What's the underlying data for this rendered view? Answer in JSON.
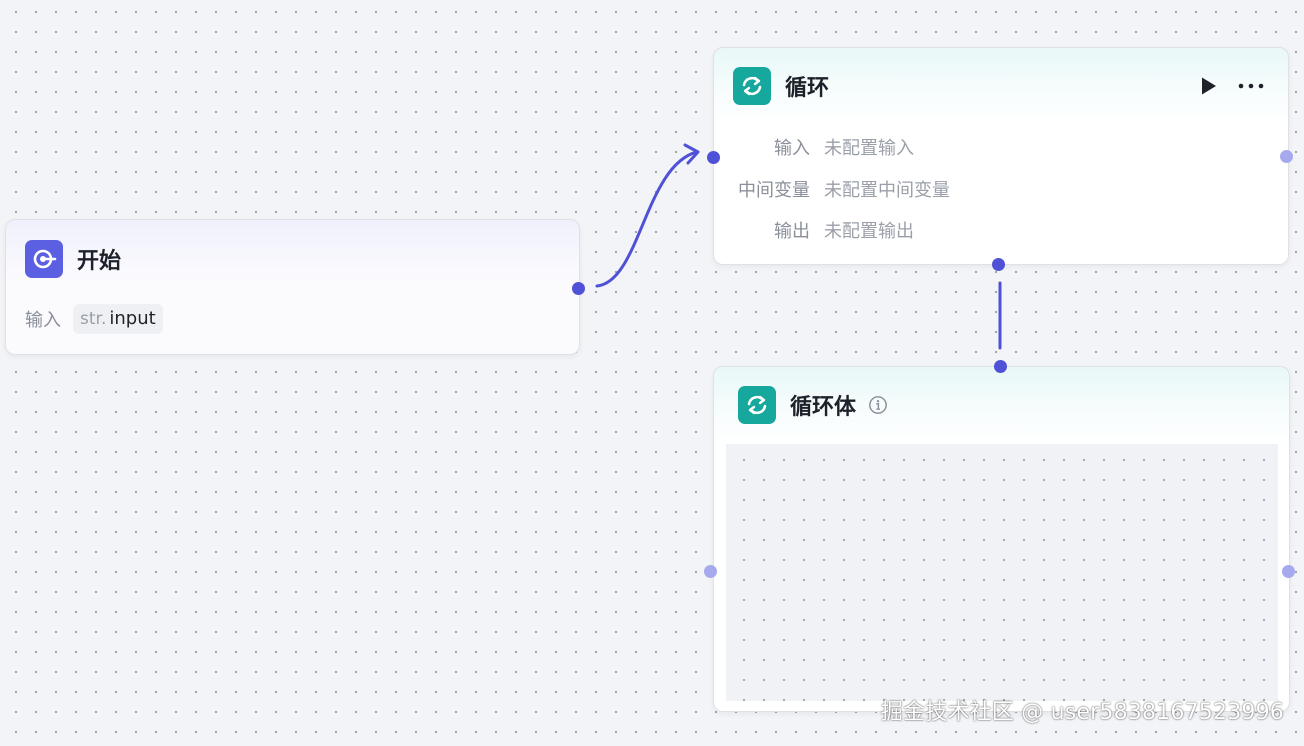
{
  "colors": {
    "canvas_bg": "#f3f4f7",
    "edge": "#4f52d6",
    "start_icon_bg": "#5b5fe2",
    "loop_icon_bg": "#16a89c"
  },
  "nodes": {
    "start": {
      "title": "开始",
      "icon": "start-icon",
      "input_label": "输入",
      "input_var": {
        "type": "str.",
        "name": "input"
      }
    },
    "loop": {
      "title": "循环",
      "icon": "loop-icon",
      "rows": [
        {
          "label": "输入",
          "value": "未配置输入"
        },
        {
          "label": "中间变量",
          "value": "未配置中间变量"
        },
        {
          "label": "输出",
          "value": "未配置输出"
        }
      ],
      "actions": [
        "play-icon",
        "more-icon"
      ]
    },
    "loop_body": {
      "title": "循环体",
      "icon": "loop-icon",
      "info_icon": "info-icon"
    }
  },
  "watermark": "掘金技术社区 @ user5838167523996"
}
